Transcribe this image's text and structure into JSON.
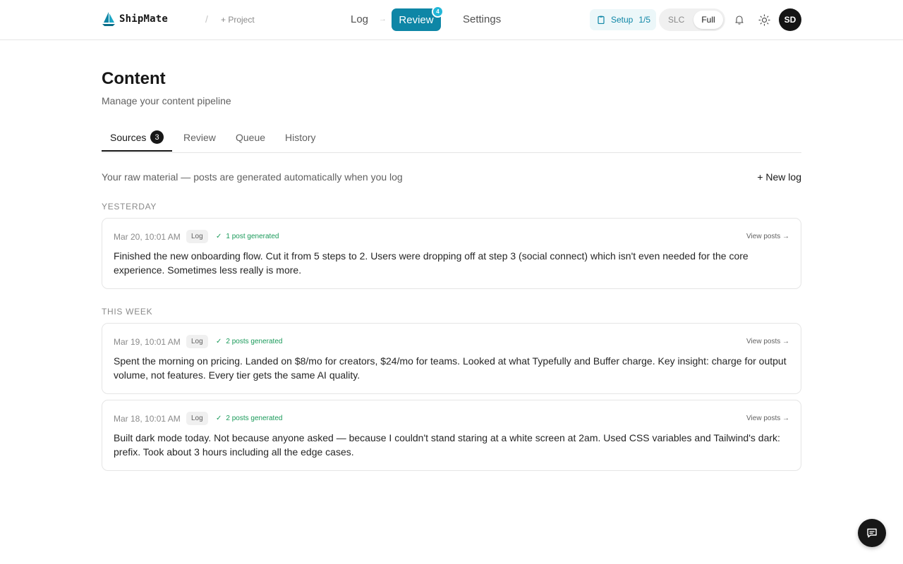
{
  "app": {
    "name": "ShipMate",
    "separator": "/",
    "project_label": "+ Project"
  },
  "nav": {
    "log": "Log",
    "arrow": "→",
    "review": "Review",
    "review_badge": "4",
    "settings": "Settings"
  },
  "setup": {
    "label": "Setup",
    "progress": "1/5"
  },
  "mode": {
    "options": [
      "SLC",
      "Full"
    ],
    "selected": "Full"
  },
  "user": {
    "initials": "SD"
  },
  "page": {
    "title": "Content",
    "subtitle": "Manage your content pipeline"
  },
  "tabs": [
    {
      "label": "Sources",
      "count": "3",
      "active": true
    },
    {
      "label": "Review"
    },
    {
      "label": "Queue"
    },
    {
      "label": "History"
    }
  ],
  "sources": {
    "intro": "Your raw material — posts are generated automatically when you log",
    "new_log": "+ New log",
    "sections": [
      {
        "label": "YESTERDAY",
        "entries": [
          {
            "date": "Mar 20, 10:01 AM",
            "tag": "Log",
            "generated": "1 post generated",
            "view": "View posts →",
            "text": "Finished the new onboarding flow. Cut it from 5 steps to 2. Users were dropping off at step 3 (social connect) which isn't even needed for the core experience. Sometimes less really is more."
          }
        ]
      },
      {
        "label": "THIS WEEK",
        "entries": [
          {
            "date": "Mar 19, 10:01 AM",
            "tag": "Log",
            "generated": "2 posts generated",
            "view": "View posts →",
            "text": "Spent the morning on pricing. Landed on $8/mo for creators, $24/mo for teams. Looked at what Typefully and Buffer charge. Key insight: charge for output volume, not features. Every tier gets the same AI quality."
          },
          {
            "date": "Mar 18, 10:01 AM",
            "tag": "Log",
            "generated": "2 posts generated",
            "view": "View posts →",
            "text": "Built dark mode today. Not because anyone asked — because I couldn't stand staring at a white screen at 2am. Used CSS variables and Tailwind's dark: prefix. Took about 3 hours including all the edge cases."
          }
        ]
      }
    ]
  },
  "icons": {
    "logo": "sailboat-logo-icon",
    "setup": "clipboard-icon",
    "notifications": "bell-icon",
    "theme": "sun-icon",
    "chat": "chat-bubble-icon",
    "generated": "check-icon"
  },
  "colors": {
    "accent": "#0e86a6",
    "accent_light": "#ecf7f9",
    "success": "#1a9a5a",
    "text": "#171717",
    "muted": "#8a8a8a"
  }
}
